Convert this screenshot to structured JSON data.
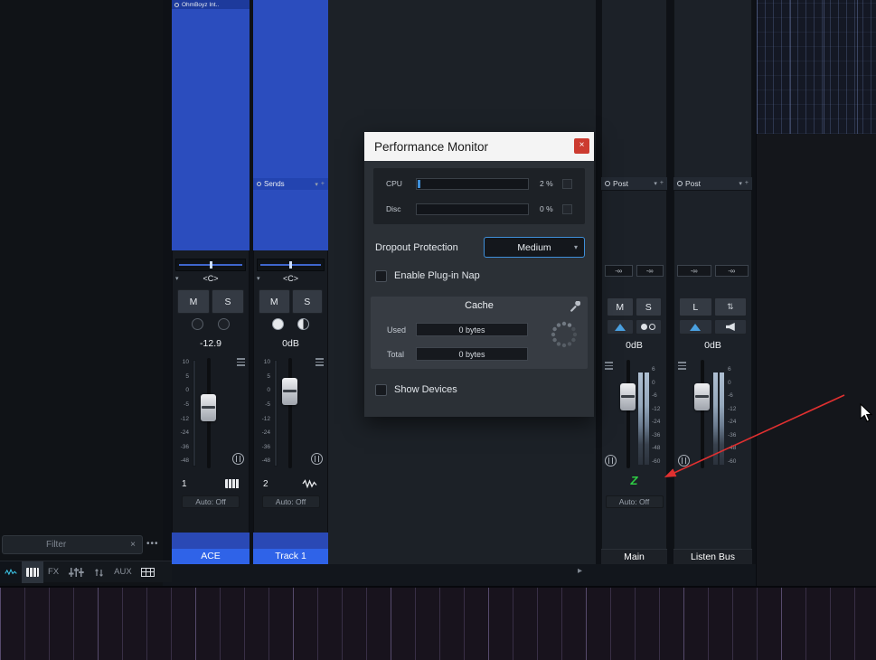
{
  "dialog": {
    "title": "Performance Monitor",
    "close_label": "×",
    "cpu": {
      "label": "CPU",
      "value": "2 %"
    },
    "disc": {
      "label": "Disc",
      "value": "0 %"
    },
    "dropout": {
      "label": "Dropout Protection",
      "value": "Medium",
      "chevron": "▾"
    },
    "plugin_nap_label": "Enable Plug-in Nap",
    "cache": {
      "title": "Cache",
      "used_label": "Used",
      "used_value": "0 bytes",
      "total_label": "Total",
      "total_value": "0 bytes"
    },
    "show_devices_label": "Show Devices"
  },
  "strips": {
    "ace": {
      "device": "OhmBoyz Int..",
      "pan": "<C>",
      "expander": "▾",
      "mute": "M",
      "solo": "S",
      "gain": "-12.9",
      "index": "1",
      "auto": "Auto: Off",
      "name": "ACE",
      "scale": [
        "10",
        "5",
        "0",
        "-5",
        "-12",
        "-24",
        "-36",
        "-48"
      ]
    },
    "track1": {
      "sends": "Sends",
      "header_chevron": "▾",
      "header_plus": "+",
      "pan": "<C>",
      "expander": "▾",
      "mute": "M",
      "solo": "S",
      "gain": "0dB",
      "index": "2",
      "auto": "Auto: Off",
      "name": "Track 1",
      "scale": [
        "10",
        "5",
        "0",
        "-5",
        "-12",
        "-24",
        "-36",
        "-48"
      ]
    },
    "main": {
      "route": "Post",
      "header_chevron": "▾",
      "header_plus": "+",
      "peak_l": "-∞",
      "peak_r": "-∞",
      "mute": "M",
      "solo": "S",
      "gain": "0dB",
      "z": "Z",
      "auto": "Auto: Off",
      "name": "Main",
      "scale": [
        "6",
        "0",
        "-6",
        "-12",
        "-24",
        "-36",
        "-48",
        "-60"
      ]
    },
    "listen": {
      "route": "Post",
      "header_chevron": "▾",
      "header_plus": "+",
      "peak_l": "-∞",
      "peak_r": "-∞",
      "listen": "L",
      "updown": "⇅",
      "gain": "0dB",
      "name": "Listen Bus",
      "scale": [
        "6",
        "0",
        "-6",
        "-12",
        "-24",
        "-36",
        "-48",
        "-60"
      ]
    }
  },
  "bottom_bar": {
    "filter_placeholder": "Filter",
    "clear": "×",
    "more": "•••",
    "fx": "FX",
    "aux": "AUX"
  },
  "mixer": {
    "scroll_right": "▸"
  },
  "colors": {
    "track_blue": "#2b4dbe",
    "name_blue": "#2f63e8",
    "accent_blue": "#3f8fd9",
    "z_green": "#2ecc44",
    "close_red": "#cc3b30",
    "arrow_red": "#e03030"
  }
}
